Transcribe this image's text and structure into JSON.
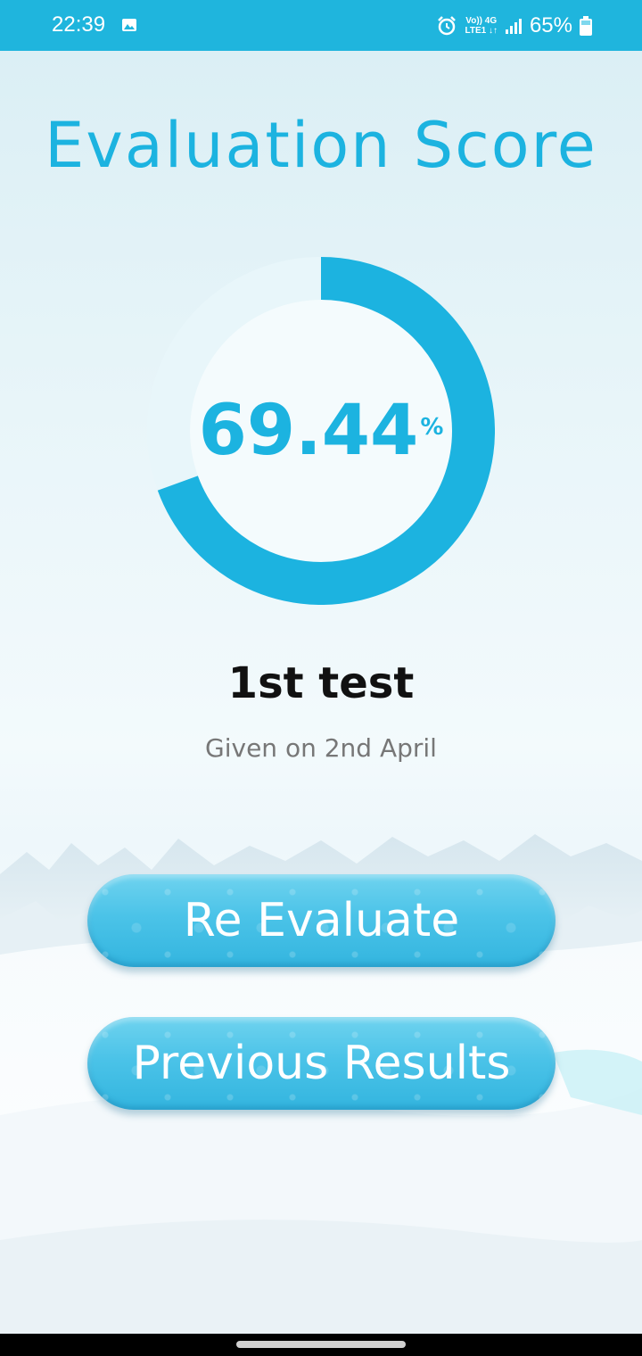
{
  "status_bar": {
    "time": "22:39",
    "network_top": "Vo)) 4G",
    "network_bottom": "LTE1 ↓↑",
    "battery": "65%",
    "icons": [
      "gallery-icon",
      "alarm-icon",
      "signal-icon",
      "battery-icon"
    ],
    "color": "#1fb5dd"
  },
  "title": "Evaluation Score",
  "score": {
    "value": "69.44",
    "unit": "%",
    "fraction": 0.6944,
    "accent_color": "#1cb3e0",
    "track_color": "#e8f6fa"
  },
  "test": {
    "name": "1st test",
    "date": "Given on 2nd April"
  },
  "buttons": {
    "re_evaluate": "Re Evaluate",
    "previous_results": "Previous Results"
  }
}
